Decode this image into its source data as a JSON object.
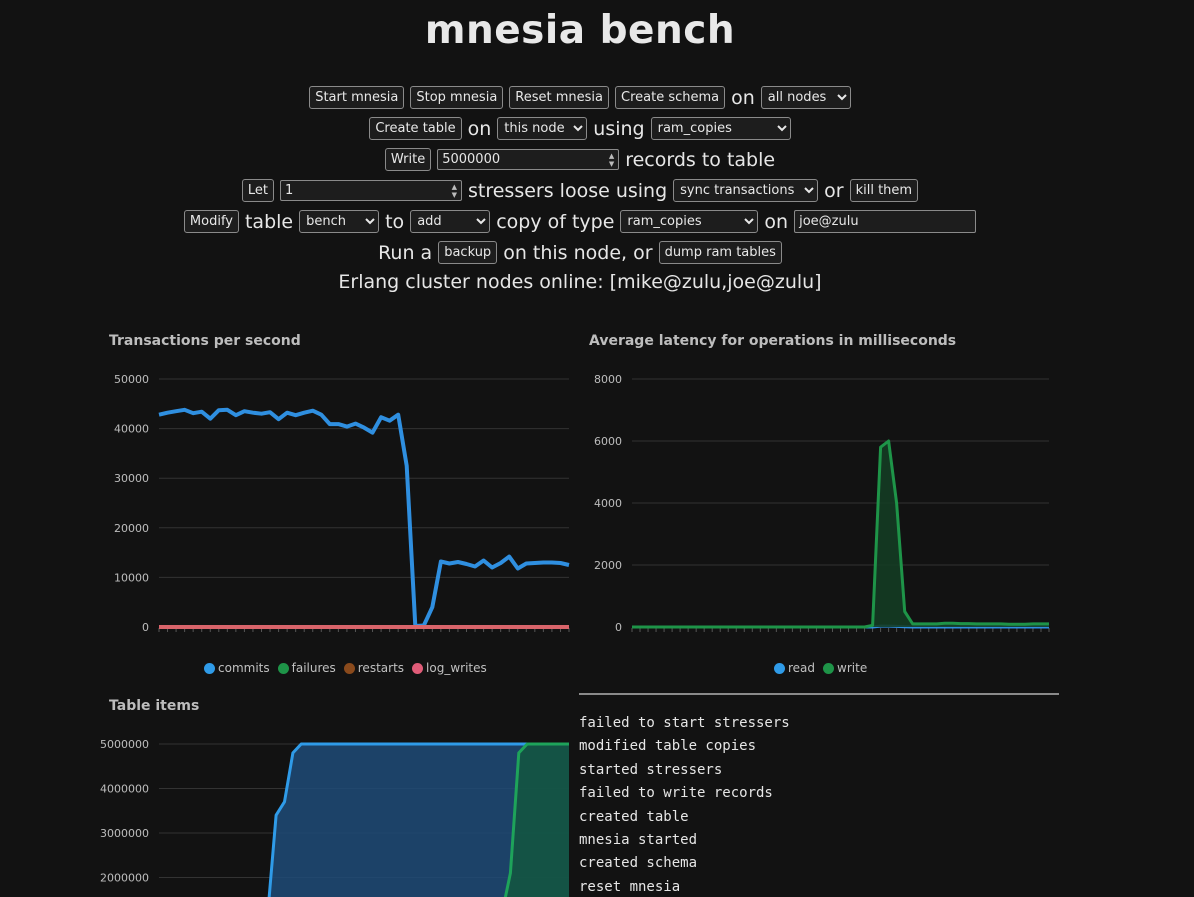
{
  "title": "mnesia bench",
  "controls": {
    "row1": {
      "start": "Start mnesia",
      "stop": "Stop mnesia",
      "reset": "Reset mnesia",
      "create_schema": "Create schema",
      "on_text": "on",
      "nodes_select": "all nodes"
    },
    "row2": {
      "create_table": "Create table",
      "on_text": "on",
      "node_select": "this node",
      "using_text": "using",
      "type_select": "ram_copies"
    },
    "row3": {
      "write": "Write",
      "records_value": "5000000",
      "records_text": "records to table"
    },
    "row4": {
      "let": "Let",
      "stressers_value": "1",
      "stressers_text": "stressers loose using",
      "mode_select": "sync transactions",
      "or_text": "or",
      "kill": "kill them"
    },
    "row5": {
      "modify": "Modify",
      "table_text": "table",
      "table_select": "bench",
      "to_text": "to",
      "action_select": "add",
      "copy_text": "copy of type",
      "copy_type_select": "ram_copies",
      "on_text": "on",
      "node_value": "joe@zulu"
    },
    "row6": {
      "run_text": "Run a",
      "backup": "backup",
      "node_text": "on this node, or",
      "dump": "dump ram tables"
    },
    "cluster_text": "Erlang cluster nodes online: [mike@zulu,joe@zulu]"
  },
  "charts": {
    "tps": {
      "title": "Transactions per second",
      "ylim": [
        0,
        50000
      ],
      "yticks": [
        "0",
        "10000",
        "20000",
        "30000",
        "40000",
        "50000"
      ],
      "legend": [
        {
          "name": "commits",
          "color": "#2f9be8"
        },
        {
          "name": "failures",
          "color": "#1e9448"
        },
        {
          "name": "restarts",
          "color": "#8a4a1c"
        },
        {
          "name": "log_writes",
          "color": "#e05c78"
        }
      ]
    },
    "latency": {
      "title": "Average latency for operations in milliseconds",
      "ylim": [
        0,
        8000
      ],
      "yticks": [
        "0",
        "2000",
        "4000",
        "6000",
        "8000"
      ],
      "legend": [
        {
          "name": "read",
          "color": "#2f9be8"
        },
        {
          "name": "write",
          "color": "#1e9448"
        }
      ]
    },
    "items": {
      "title": "Table items",
      "yticks": [
        "2000000",
        "3000000",
        "4000000",
        "5000000"
      ]
    }
  },
  "chart_data": [
    {
      "type": "line",
      "title": "Transactions per second",
      "ylim": [
        0,
        50000
      ],
      "series": [
        {
          "name": "commits",
          "values": [
            42800,
            43200,
            43500,
            43800,
            43100,
            43400,
            42000,
            43700,
            43800,
            42700,
            43500,
            43200,
            43000,
            43300,
            41900,
            43200,
            42700,
            43200,
            43600,
            42800,
            40900,
            40900,
            40400,
            41000,
            40200,
            39200,
            42300,
            41600,
            42800,
            32500,
            200,
            300,
            4000,
            13200,
            12800,
            13100,
            12700,
            12200,
            13400,
            12000,
            12900,
            14200,
            11800,
            12800,
            12900,
            13000,
            13000,
            12900,
            12500
          ]
        },
        {
          "name": "failures",
          "values": [
            0,
            0,
            0,
            0,
            0,
            0,
            0,
            0,
            0,
            0,
            0,
            0,
            0,
            0,
            0,
            0,
            0,
            0,
            0,
            0,
            0,
            0,
            0,
            0,
            0,
            0,
            0,
            0,
            0,
            0,
            0,
            0,
            0,
            0,
            0,
            0,
            0,
            0,
            0,
            0,
            0,
            0,
            0,
            0,
            0,
            0,
            0,
            0,
            0
          ]
        },
        {
          "name": "restarts",
          "values": [
            0,
            0,
            0,
            0,
            0,
            0,
            0,
            0,
            0,
            0,
            0,
            0,
            0,
            0,
            0,
            0,
            0,
            0,
            0,
            0,
            0,
            0,
            0,
            0,
            0,
            0,
            0,
            0,
            0,
            0,
            0,
            0,
            0,
            0,
            0,
            0,
            0,
            0,
            0,
            0,
            0,
            0,
            0,
            0,
            0,
            0,
            0,
            0,
            0
          ]
        },
        {
          "name": "log_writes",
          "values": [
            0,
            0,
            0,
            0,
            0,
            0,
            0,
            0,
            0,
            0,
            0,
            0,
            0,
            0,
            0,
            0,
            0,
            0,
            0,
            0,
            0,
            0,
            0,
            0,
            0,
            0,
            0,
            0,
            0,
            0,
            0,
            0,
            0,
            0,
            0,
            0,
            0,
            0,
            0,
            0,
            0,
            0,
            0,
            0,
            0,
            0,
            0,
            0,
            0
          ]
        }
      ]
    },
    {
      "type": "area",
      "title": "Average latency for operations in milliseconds",
      "ylim": [
        0,
        8000
      ],
      "series": [
        {
          "name": "read",
          "values": [
            0,
            0,
            0,
            0,
            0,
            0,
            0,
            0,
            0,
            0,
            0,
            0,
            0,
            0,
            0,
            0,
            0,
            0,
            0,
            0,
            0,
            0,
            0,
            0,
            0,
            0,
            0,
            0,
            0,
            0,
            0,
            30,
            30,
            20,
            10,
            0,
            0,
            0,
            0,
            0,
            0,
            0,
            0,
            0,
            0,
            0,
            0,
            0,
            0,
            0,
            0,
            0,
            0
          ]
        },
        {
          "name": "write",
          "values": [
            0,
            0,
            0,
            0,
            0,
            0,
            0,
            0,
            0,
            0,
            0,
            0,
            0,
            0,
            0,
            0,
            0,
            0,
            0,
            0,
            0,
            0,
            0,
            0,
            0,
            0,
            0,
            0,
            0,
            0,
            50,
            5800,
            6000,
            4000,
            500,
            100,
            100,
            100,
            100,
            120,
            120,
            110,
            110,
            100,
            100,
            100,
            100,
            90,
            90,
            90,
            100,
            100,
            100
          ]
        }
      ]
    },
    {
      "type": "area",
      "title": "Table items",
      "series": [
        {
          "name": "",
          "values": [
            null,
            null,
            null,
            null,
            null,
            null,
            null,
            null,
            null,
            null,
            null,
            null,
            null,
            1200000,
            3400000,
            3700000,
            4800000,
            5000000,
            5000000,
            5000000,
            5000000,
            5000000,
            5000000,
            5000000,
            5000000,
            5000000,
            5000000,
            5000000,
            5000000,
            5000000,
            5000000,
            5000000,
            5000000,
            5000000,
            5000000,
            5000000,
            5000000,
            5000000,
            5000000,
            5000000,
            5000000,
            5000000,
            5000000,
            5000000,
            5000000,
            5000000,
            5000000,
            5000000,
            5000000,
            5000000
          ]
        },
        {
          "name": "",
          "values": [
            null,
            null,
            null,
            null,
            null,
            null,
            null,
            null,
            null,
            null,
            null,
            null,
            null,
            null,
            null,
            null,
            null,
            null,
            null,
            null,
            null,
            null,
            null,
            null,
            null,
            null,
            null,
            null,
            null,
            null,
            null,
            null,
            null,
            null,
            null,
            null,
            null,
            null,
            null,
            null,
            null,
            1200000,
            2100000,
            4800000,
            5000000,
            5000000,
            5000000,
            5000000,
            5000000,
            5000000
          ]
        }
      ]
    }
  ],
  "log": [
    "failed to start stressers",
    "modified table copies",
    "started stressers",
    "failed to write records",
    "created table",
    "mnesia started",
    "created schema",
    "reset mnesia"
  ]
}
